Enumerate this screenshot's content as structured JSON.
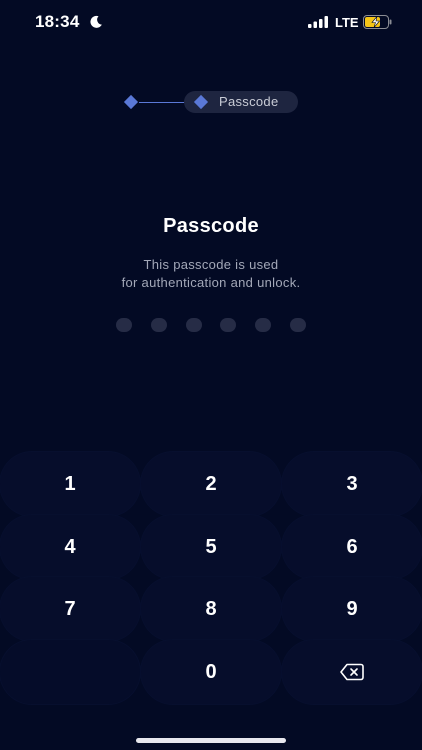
{
  "status_bar": {
    "time": "18:34",
    "network": "LTE",
    "icons": [
      "moon-icon",
      "signal-icon",
      "battery-charging-icon"
    ]
  },
  "stepper": {
    "current_step_label": "Passcode"
  },
  "header": {
    "title": "Passcode",
    "description_line1": "This passcode is used",
    "description_line2": "for authentication and unlock."
  },
  "passcode": {
    "length": 6,
    "filled": 0
  },
  "keypad": {
    "keys": [
      "1",
      "2",
      "3",
      "4",
      "5",
      "6",
      "7",
      "8",
      "9",
      "",
      "0",
      "backspace"
    ]
  },
  "colors": {
    "background": "#030a24",
    "accent": "#5a78d6",
    "pill": "#1e2540",
    "dot": "#262c46",
    "muted_text": "#a3a8b8"
  }
}
